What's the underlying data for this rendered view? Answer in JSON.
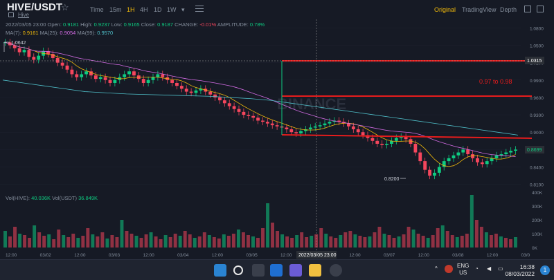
{
  "header": {
    "pair": "HIVE/USDT",
    "star_icon": "star-icon",
    "sub_label": "Hive",
    "timeframes": [
      "Time",
      "15m",
      "1H",
      "4H",
      "1D",
      "1W"
    ],
    "active_timeframe": "1H",
    "views": [
      "Original",
      "TradingView",
      "Depth"
    ],
    "active_view": "Original"
  },
  "ohlc": {
    "date": "2022/03/05 23:00",
    "open_label": "Open:",
    "open": "0.9181",
    "high_label": "High:",
    "high": "0.9237",
    "low_label": "Low:",
    "low": "0.9165",
    "close_label": "Close:",
    "close": "0.9187",
    "change_label": "CHANGE:",
    "change": "-0.01%",
    "amp_label": "AMPLITUDE:",
    "amp": "0.78%"
  },
  "ma": {
    "ma7_label": "MA(7):",
    "ma7": "0.9161",
    "ma25_label": "MA(25):",
    "ma25": "0.9054",
    "ma99_label": "MA(99):",
    "ma99": "0.9570"
  },
  "vol": {
    "hive_label": "Vol(HIVE):",
    "hive": "40.036K",
    "usdt_label": "Vol(USDT)",
    "usdt": "36.849K"
  },
  "price_axis": [
    "1.0800",
    "1.0500",
    "1.0200",
    "0.9900",
    "0.9600",
    "0.9300",
    "0.9000",
    "0.8700",
    "0.8400",
    "0.8100"
  ],
  "vol_axis": [
    "400K",
    "300K",
    "200K",
    "100K",
    "0K"
  ],
  "time_axis": [
    "12:00",
    "03/02",
    "12:00",
    "03/03",
    "12:00",
    "03/04",
    "12:00",
    "03/05",
    "12:00",
    "03/06",
    "12:00",
    "03/07",
    "12:00",
    "03/08",
    "12:00",
    "03/0"
  ],
  "annotations": {
    "high_marker": "1.0642",
    "low_marker": "0.8200",
    "range_label": "0.97 to 0.98",
    "crosshair_price": "1.0315",
    "current_price": "0.8699",
    "crosshair_time": "2022/03/05 23:00",
    "watermark": "BINANCE"
  },
  "chart_data": {
    "type": "candlestick",
    "ylim": [
      0.8,
      1.09
    ],
    "series": [
      {
        "name": "MA(7)",
        "color": "#f0b90b"
      },
      {
        "name": "MA(25)",
        "color": "#d26be3"
      },
      {
        "name": "MA(99)",
        "color": "#4fbfc9"
      }
    ],
    "close_path": [
      1.055,
      1.05,
      1.045,
      1.038,
      1.042,
      1.03,
      1.025,
      1.032,
      1.04,
      1.035,
      1.028,
      1.02,
      1.015,
      1.008,
      1.0,
      0.995,
      1.0,
      1.005,
      0.998,
      0.992,
      0.995,
      0.99,
      0.985,
      0.99,
      0.995,
      1.0,
      1.005,
      0.998,
      0.992,
      0.985,
      0.99,
      0.995,
      1.0,
      0.995,
      0.99,
      0.985,
      0.98,
      0.975,
      0.97,
      0.968,
      0.972,
      0.975,
      0.97,
      0.965,
      0.96,
      0.955,
      0.95,
      0.945,
      0.94,
      0.935,
      0.93,
      0.928,
      0.925,
      0.92,
      0.918,
      0.915,
      0.912,
      0.91,
      0.908,
      0.905,
      0.9,
      0.898,
      0.902,
      0.905,
      0.908,
      0.91,
      0.912,
      0.915,
      0.918,
      0.92,
      0.918,
      0.915,
      0.91,
      0.905,
      0.9,
      0.895,
      0.89,
      0.885,
      0.88,
      0.878,
      0.88,
      0.885,
      0.89,
      0.892,
      0.888,
      0.88,
      0.865,
      0.85,
      0.835,
      0.825,
      0.83,
      0.84,
      0.85,
      0.855,
      0.86,
      0.865,
      0.87,
      0.862,
      0.855,
      0.848,
      0.845,
      0.85,
      0.855,
      0.86,
      0.862,
      0.865,
      0.868,
      0.87
    ],
    "ma99_path": [
      0.99,
      0.985,
      0.98,
      0.975,
      0.97,
      0.968,
      0.966,
      0.965,
      0.964,
      0.963,
      0.962,
      0.96,
      0.958,
      0.955,
      0.95,
      0.945,
      0.94,
      0.935,
      0.93,
      0.925,
      0.92,
      0.915,
      0.91,
      0.905,
      0.9,
      0.895
    ],
    "volume_k": [
      120,
      80,
      150,
      100,
      90,
      70,
      160,
      110,
      85,
      95,
      60,
      130,
      90,
      75,
      100,
      70,
      85,
      140,
      95,
      80,
      110,
      65,
      90,
      75,
      200,
      120,
      100,
      85,
      70,
      95,
      110,
      80,
      60,
      90,
      75,
      100,
      85,
      120,
      95,
      70,
      80,
      110,
      90,
      75,
      65,
      95,
      85,
      100,
      130,
      110,
      90,
      80,
      70,
      140,
      320,
      180,
      120,
      95,
      80,
      70,
      90,
      110,
      75,
      85,
      95,
      140,
      100,
      80,
      70,
      90,
      110,
      120,
      95,
      85,
      75,
      80,
      110,
      150,
      100,
      90,
      70,
      80,
      95,
      150,
      130,
      100,
      85,
      70,
      90,
      140,
      160,
      120,
      90,
      75,
      85,
      100,
      380,
      200,
      150,
      110,
      90,
      100,
      80,
      70,
      60,
      75
    ]
  }
}
